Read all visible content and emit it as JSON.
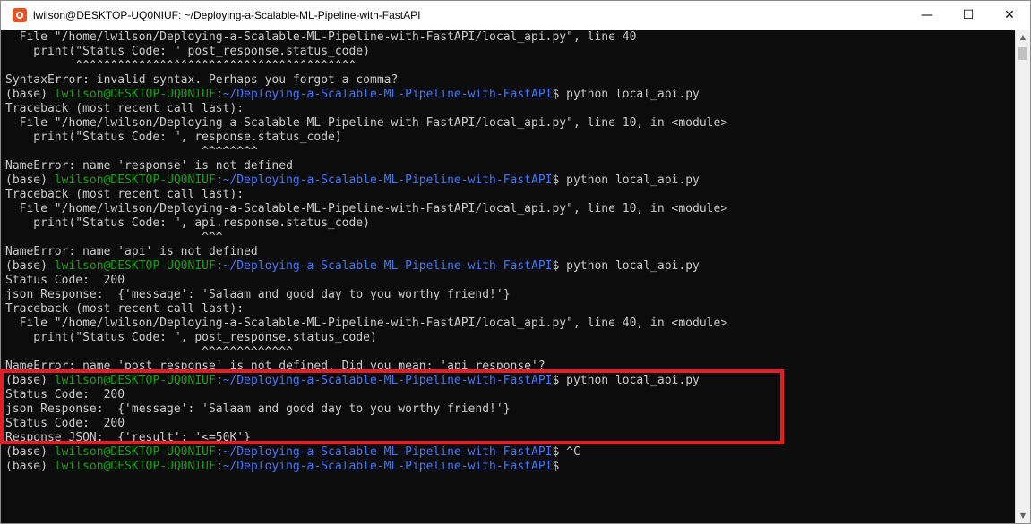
{
  "window": {
    "title": "lwilson@DESKTOP-UQ0NIUF: ~/Deploying-a-Scalable-ML-Pipeline-with-FastAPI",
    "controls": {
      "minimize": "—",
      "maximize": "☐",
      "close": "✕"
    }
  },
  "colors": {
    "prompt_user": "#13a10e",
    "prompt_path": "#3b78ff",
    "text": "#cccccc",
    "highlight": "#e31e24",
    "background": "#0c0c0c"
  },
  "terminal": {
    "lines": [
      [
        {
          "t": "  File \"/home/lwilson/Deploying-a-Scalable-ML-Pipeline-with-FastAPI/local_api.py\", line 40",
          "c": "w"
        }
      ],
      [
        {
          "t": "    print(\"Status Code: \" post_response.status_code)",
          "c": "w"
        }
      ],
      [
        {
          "t": "          ^^^^^^^^^^^^^^^^^^^^^^^^^^^^^^^^^^^^^^^^",
          "c": "w"
        }
      ],
      [
        {
          "t": "SyntaxError: invalid syntax. Perhaps you forgot a comma?",
          "c": "w"
        }
      ],
      [
        {
          "t": "(base) ",
          "c": "w"
        },
        {
          "t": "lwilson@DESKTOP-UQ0NIUF",
          "c": "g"
        },
        {
          "t": ":",
          "c": "w"
        },
        {
          "t": "~/Deploying-a-Scalable-ML-Pipeline-with-FastAPI",
          "c": "b"
        },
        {
          "t": "$ python local_api.py",
          "c": "w"
        }
      ],
      [
        {
          "t": "Traceback (most recent call last):",
          "c": "w"
        }
      ],
      [
        {
          "t": "  File \"/home/lwilson/Deploying-a-Scalable-ML-Pipeline-with-FastAPI/local_api.py\", line 10, in <module>",
          "c": "w"
        }
      ],
      [
        {
          "t": "    print(\"Status Code: \", response.status_code)",
          "c": "w"
        }
      ],
      [
        {
          "t": "                            ^^^^^^^^",
          "c": "w"
        }
      ],
      [
        {
          "t": "NameError: name 'response' is not defined",
          "c": "w"
        }
      ],
      [
        {
          "t": "(base) ",
          "c": "w"
        },
        {
          "t": "lwilson@DESKTOP-UQ0NIUF",
          "c": "g"
        },
        {
          "t": ":",
          "c": "w"
        },
        {
          "t": "~/Deploying-a-Scalable-ML-Pipeline-with-FastAPI",
          "c": "b"
        },
        {
          "t": "$ python local_api.py",
          "c": "w"
        }
      ],
      [
        {
          "t": "Traceback (most recent call last):",
          "c": "w"
        }
      ],
      [
        {
          "t": "  File \"/home/lwilson/Deploying-a-Scalable-ML-Pipeline-with-FastAPI/local_api.py\", line 10, in <module>",
          "c": "w"
        }
      ],
      [
        {
          "t": "    print(\"Status Code: \", api.response.status_code)",
          "c": "w"
        }
      ],
      [
        {
          "t": "                            ^^^",
          "c": "w"
        }
      ],
      [
        {
          "t": "NameError: name 'api' is not defined",
          "c": "w"
        }
      ],
      [
        {
          "t": "(base) ",
          "c": "w"
        },
        {
          "t": "lwilson@DESKTOP-UQ0NIUF",
          "c": "g"
        },
        {
          "t": ":",
          "c": "w"
        },
        {
          "t": "~/Deploying-a-Scalable-ML-Pipeline-with-FastAPI",
          "c": "b"
        },
        {
          "t": "$ python local_api.py",
          "c": "w"
        }
      ],
      [
        {
          "t": "Status Code:  200",
          "c": "w"
        }
      ],
      [
        {
          "t": "json Response:  {'message': 'Salaam and good day to you worthy friend!'}",
          "c": "w"
        }
      ],
      [
        {
          "t": "Traceback (most recent call last):",
          "c": "w"
        }
      ],
      [
        {
          "t": "  File \"/home/lwilson/Deploying-a-Scalable-ML-Pipeline-with-FastAPI/local_api.py\", line 40, in <module>",
          "c": "w"
        }
      ],
      [
        {
          "t": "    print(\"Status Code: \", post_response.status_code)",
          "c": "w"
        }
      ],
      [
        {
          "t": "                            ^^^^^^^^^^^^^",
          "c": "w"
        }
      ],
      [
        {
          "t": "NameError: name 'post_response' is not defined. Did you mean: 'api_response'?",
          "c": "w"
        }
      ],
      [
        {
          "t": "(base) ",
          "c": "w"
        },
        {
          "t": "lwilson@DESKTOP-UQ0NIUF",
          "c": "g"
        },
        {
          "t": ":",
          "c": "w"
        },
        {
          "t": "~/Deploying-a-Scalable-ML-Pipeline-with-FastAPI",
          "c": "b"
        },
        {
          "t": "$ python local_api.py",
          "c": "w"
        }
      ],
      [
        {
          "t": "Status Code:  200",
          "c": "w"
        }
      ],
      [
        {
          "t": "json Response:  {'message': 'Salaam and good day to you worthy friend!'}",
          "c": "w"
        }
      ],
      [
        {
          "t": "Status Code:  200",
          "c": "w"
        }
      ],
      [
        {
          "t": "Response JSON:  {'result': '<=50K'}",
          "c": "w"
        }
      ],
      [
        {
          "t": "(base) ",
          "c": "w"
        },
        {
          "t": "lwilson@DESKTOP-UQ0NIUF",
          "c": "g"
        },
        {
          "t": ":",
          "c": "w"
        },
        {
          "t": "~/Deploying-a-Scalable-ML-Pipeline-with-FastAPI",
          "c": "b"
        },
        {
          "t": "$ ^C",
          "c": "w"
        }
      ],
      [
        {
          "t": "(base) ",
          "c": "w"
        },
        {
          "t": "lwilson@DESKTOP-UQ0NIUF",
          "c": "g"
        },
        {
          "t": ":",
          "c": "w"
        },
        {
          "t": "~/Deploying-a-Scalable-ML-Pipeline-with-FastAPI",
          "c": "b"
        },
        {
          "t": "$",
          "c": "w"
        }
      ]
    ]
  }
}
